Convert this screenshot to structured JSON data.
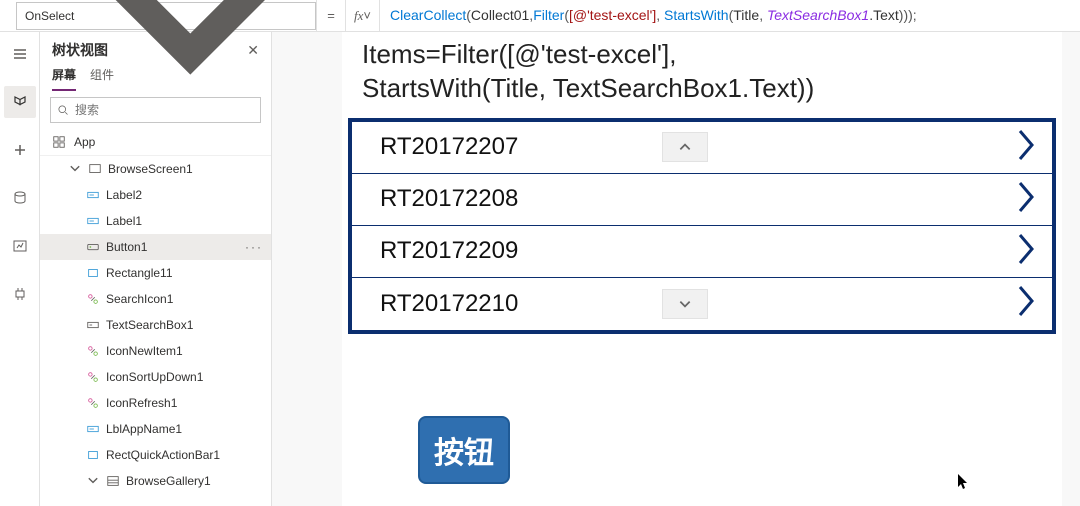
{
  "property_selector": {
    "value": "OnSelect"
  },
  "formula": {
    "fn1": "ClearCollect",
    "open1": "(",
    "arg1": "Collect01",
    "comma1": ",",
    "fn2": "Filter",
    "open2": "(",
    "str1": "[@'test-excel']",
    "comma2": ", ",
    "fn3": "StartsWith",
    "open3": "(",
    "arg2": "Title",
    "comma3": ", ",
    "var1": "TextSearchBox1",
    "dot": ".Text",
    "close": ")));"
  },
  "tree_panel": {
    "title": "树状视图",
    "tabs": {
      "screens": "屏幕",
      "components": "组件"
    },
    "search_placeholder": "搜索",
    "app_label": "App",
    "nodes": [
      {
        "label": "BrowseScreen1",
        "selected": false,
        "depth": 1,
        "icon": "screen",
        "expand": true
      },
      {
        "label": "Label2",
        "selected": false,
        "depth": 2,
        "icon": "label"
      },
      {
        "label": "Label1",
        "selected": false,
        "depth": 2,
        "icon": "label"
      },
      {
        "label": "Button1",
        "selected": true,
        "depth": 2,
        "icon": "button"
      },
      {
        "label": "Rectangle11",
        "selected": false,
        "depth": 2,
        "icon": "rect"
      },
      {
        "label": "SearchIcon1",
        "selected": false,
        "depth": 2,
        "icon": "iconctrl"
      },
      {
        "label": "TextSearchBox1",
        "selected": false,
        "depth": 2,
        "icon": "textbox"
      },
      {
        "label": "IconNewItem1",
        "selected": false,
        "depth": 2,
        "icon": "iconctrl"
      },
      {
        "label": "IconSortUpDown1",
        "selected": false,
        "depth": 2,
        "icon": "iconctrl"
      },
      {
        "label": "IconRefresh1",
        "selected": false,
        "depth": 2,
        "icon": "iconctrl"
      },
      {
        "label": "LblAppName1",
        "selected": false,
        "depth": 2,
        "icon": "label"
      },
      {
        "label": "RectQuickActionBar1",
        "selected": false,
        "depth": 2,
        "icon": "rect"
      },
      {
        "label": "BrowseGallery1",
        "selected": false,
        "depth": 2,
        "icon": "gallery",
        "expand": true
      }
    ]
  },
  "canvas": {
    "heading_line1": "Items=Filter([@'test-excel'],",
    "heading_line2": "StartsWith(Title, TextSearchBox1.Text))",
    "rows": [
      "RT20172207",
      "RT20172208",
      "RT20172209",
      "RT20172210"
    ],
    "button_label": "按钮"
  }
}
